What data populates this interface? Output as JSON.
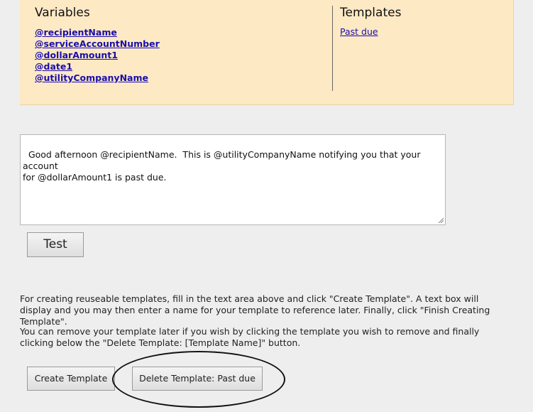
{
  "variables": {
    "title": "Variables",
    "items": [
      "@recipientName",
      "@serviceAccountNumber",
      "@dollarAmount1",
      "@date1",
      "@utilityCompanyName"
    ]
  },
  "templates": {
    "title": "Templates",
    "items": [
      "Past due"
    ]
  },
  "message": {
    "value": "Good afternoon @recipientName.  This is @utilityCompanyName notifying you that your account\nfor @dollarAmount1 is past due."
  },
  "buttons": {
    "test": "Test",
    "create_template": "Create Template",
    "delete_template": "Delete Template: Past due"
  },
  "help": {
    "create": "For creating reuseable templates, fill in the text area above and click \"Create Template\". A text box will display and you may then enter a name for your template to reference later. Finally, click \"Finish Creating Template\".",
    "remove": "You can remove your template later if you wish by clicking the template you wish to remove and finally clicking below the \"Delete Template: [Template Name]\" button."
  },
  "colors": {
    "panel_bg": "#fde9c4",
    "link": "#1a0dab",
    "page_bg": "#eeeeee",
    "annotation": "#111111"
  }
}
